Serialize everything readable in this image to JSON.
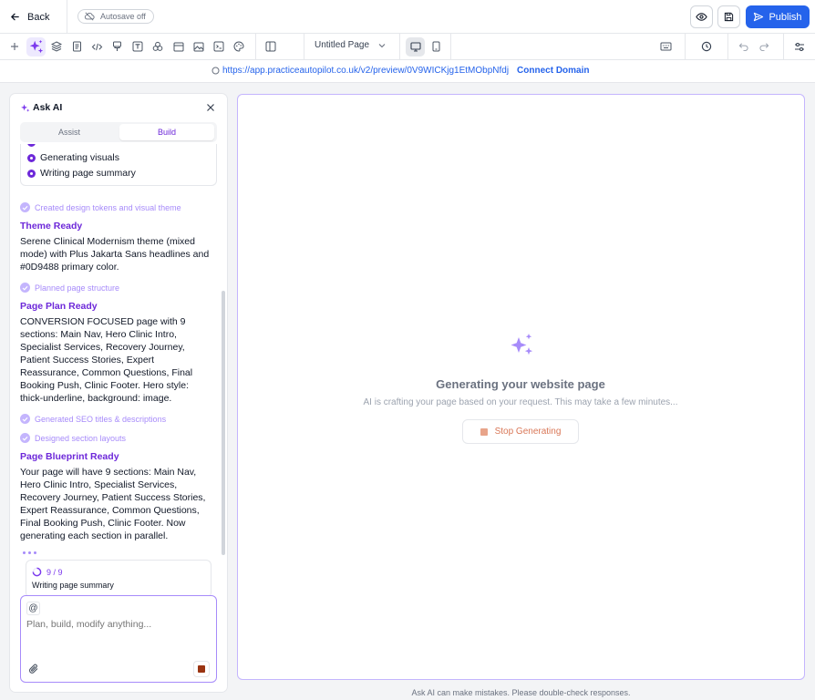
{
  "header": {
    "back_label": "Back",
    "autosave_label": "Autosave off",
    "publish_label": "Publish",
    "accent": "#2563eb"
  },
  "toolbar": {
    "page_name": "Untitled Page",
    "icons": [
      "add-icon",
      "sparkles-icon",
      "layers-icon",
      "page-icon",
      "code-icon",
      "brush-icon",
      "text-icon",
      "shapes-icon",
      "section-icon",
      "media-icon",
      "component-icon",
      "layout-icon",
      "desktop-icon",
      "mobile-icon",
      "keyboard-icon",
      "history-icon",
      "undo-icon",
      "redo-icon",
      "settings-icon"
    ]
  },
  "urlbar": {
    "url": "https://app.practiceautopilot.co.uk/v2/preview/0V9WICKjg1EtMObpNfdj",
    "connect_label": "Connect Domain"
  },
  "panel": {
    "title": "Ask AI",
    "tabs": {
      "assist": "Assist",
      "build": "Build"
    },
    "progress_items": [
      "Generating visuals",
      "Writing page summary"
    ],
    "steps": {
      "tokens": "Created design tokens and visual theme",
      "structure": "Planned page structure",
      "seo": "Generated SEO titles & descriptions",
      "layouts": "Designed section layouts"
    },
    "theme": {
      "title": "Theme Ready",
      "body": "Serene Clinical Modernism theme (mixed mode) with Plus Jakarta Sans headlines and #0D9488 primary color."
    },
    "plan": {
      "title": "Page Plan Ready",
      "body": "CONVERSION FOCUSED page with 9 sections: Main Nav, Hero Clinic Intro, Specialist Services, Recovery Journey, Patient Success Stories, Expert Reassurance, Common Questions, Final Booking Push, Clinic Footer. Hero style: thick-underline, background: image."
    },
    "blueprint": {
      "title": "Page Blueprint Ready",
      "body": "Your page will have 9 sections: Main Nav, Hero Clinic Intro, Specialist Services, Recovery Journey, Patient Success Stories, Expert Reassurance, Common Questions, Final Booking Push, Clinic Footer. Now generating each section in parallel."
    },
    "status": {
      "count": "9 / 9",
      "text": "Writing page summary"
    },
    "input": {
      "at_label": "@",
      "placeholder": "Plan, build, modify anything..."
    }
  },
  "canvas": {
    "title": "Generating your website page",
    "subtitle": "AI is crafting your page based on your request. This may take a few minutes...",
    "stop_label": "Stop Generating"
  },
  "disclaimer": "Ask AI can make mistakes. Please double-check responses."
}
